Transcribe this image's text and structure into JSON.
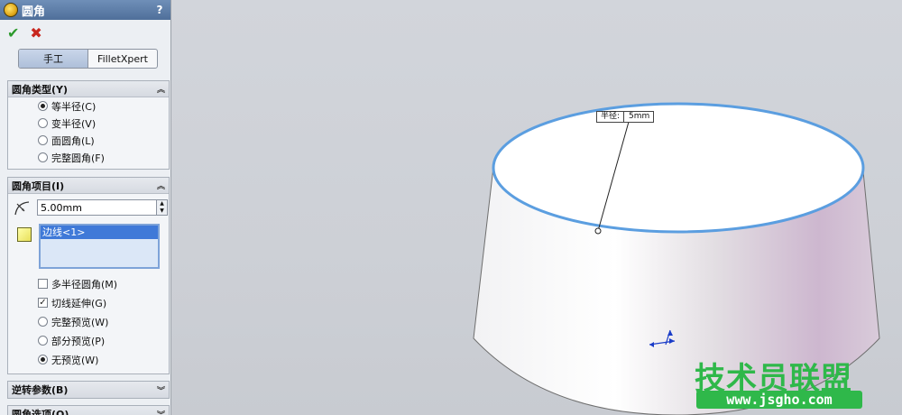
{
  "panel": {
    "title": "圆角",
    "help_label": "?",
    "ok_icon": "checkmark-icon",
    "cancel_icon": "close-icon",
    "tabs": [
      {
        "label": "手工",
        "active": true
      },
      {
        "label": "FilletXpert",
        "active": false
      }
    ],
    "fillet_type": {
      "header": "圆角类型(Y)",
      "options": [
        {
          "label": "等半径(C)",
          "selected": true
        },
        {
          "label": "变半径(V)",
          "selected": false
        },
        {
          "label": "面圆角(L)",
          "selected": false
        },
        {
          "label": "完整圆角(F)",
          "selected": false
        }
      ]
    },
    "fillet_items": {
      "header": "圆角项目(I)",
      "radius_value": "5.00mm",
      "selected_edge": "边线<1>",
      "multi_radius": {
        "label": "多半径圆角(M)",
        "checked": false
      },
      "tangent": {
        "label": "切线延伸(G)",
        "checked": true
      },
      "preview_options": [
        {
          "label": "完整预览(W)",
          "selected": false
        },
        {
          "label": "部分预览(P)",
          "selected": false
        },
        {
          "label": "无预览(W)",
          "selected": true
        }
      ]
    },
    "reverse_params": {
      "header": "逆转参数(B)"
    },
    "fillet_options": {
      "header": "圆角选项(O)"
    }
  },
  "viewport": {
    "callout_label": "半径:",
    "callout_value": "5mm",
    "edge_color": "#5b9ee0"
  },
  "watermark": {
    "title": "技术员联盟",
    "url": "www.jsgho.com",
    "color": "#2fb84a"
  }
}
